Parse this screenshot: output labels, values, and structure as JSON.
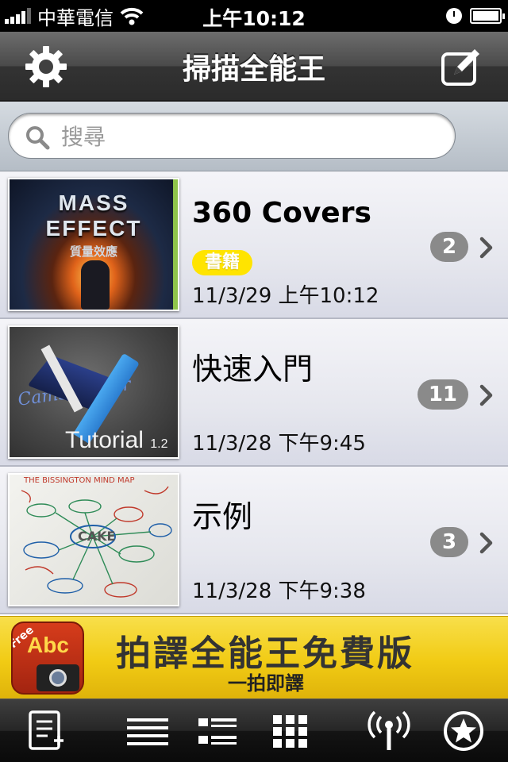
{
  "status_bar": {
    "carrier": "中華電信",
    "time": "上午10:12"
  },
  "nav": {
    "title": "掃描全能王",
    "left_icon": "gear-icon",
    "right_icon": "compose-icon"
  },
  "search": {
    "placeholder": "搜尋"
  },
  "documents": [
    {
      "title": "360 Covers",
      "tag": "書籍",
      "date": "11/3/29 上午10:12",
      "count": "2",
      "thumbnail_text": "MASS EFFECT",
      "thumbnail_subtext": "質量效應"
    },
    {
      "title": "快速入門",
      "date": "11/3/28 下午9:45",
      "count": "11",
      "thumbnail_text": "Tutorial",
      "thumbnail_subtext": "1.2",
      "thumbnail_script": "CamScanner"
    },
    {
      "title": "示例",
      "date": "11/3/28 下午9:38",
      "count": "3",
      "thumbnail_text": "THE BISSINGTON MIND MAP",
      "thumbnail_subtext": "CAKE"
    }
  ],
  "ad": {
    "title": "拍譯全能王免費版",
    "subtitle": "一拍即譯",
    "icon_badge": "Free",
    "icon_text": "Abc"
  },
  "tabbar": {
    "icons": [
      "new-document-icon",
      "list-view-icon",
      "detail-list-icon",
      "grid-view-icon",
      "wireless-icon",
      "star-icon"
    ]
  },
  "colors": {
    "tag_yellow": "#ffe400",
    "badge_gray": "#8a8a8a",
    "ad_yellow": "#f1cb14"
  }
}
